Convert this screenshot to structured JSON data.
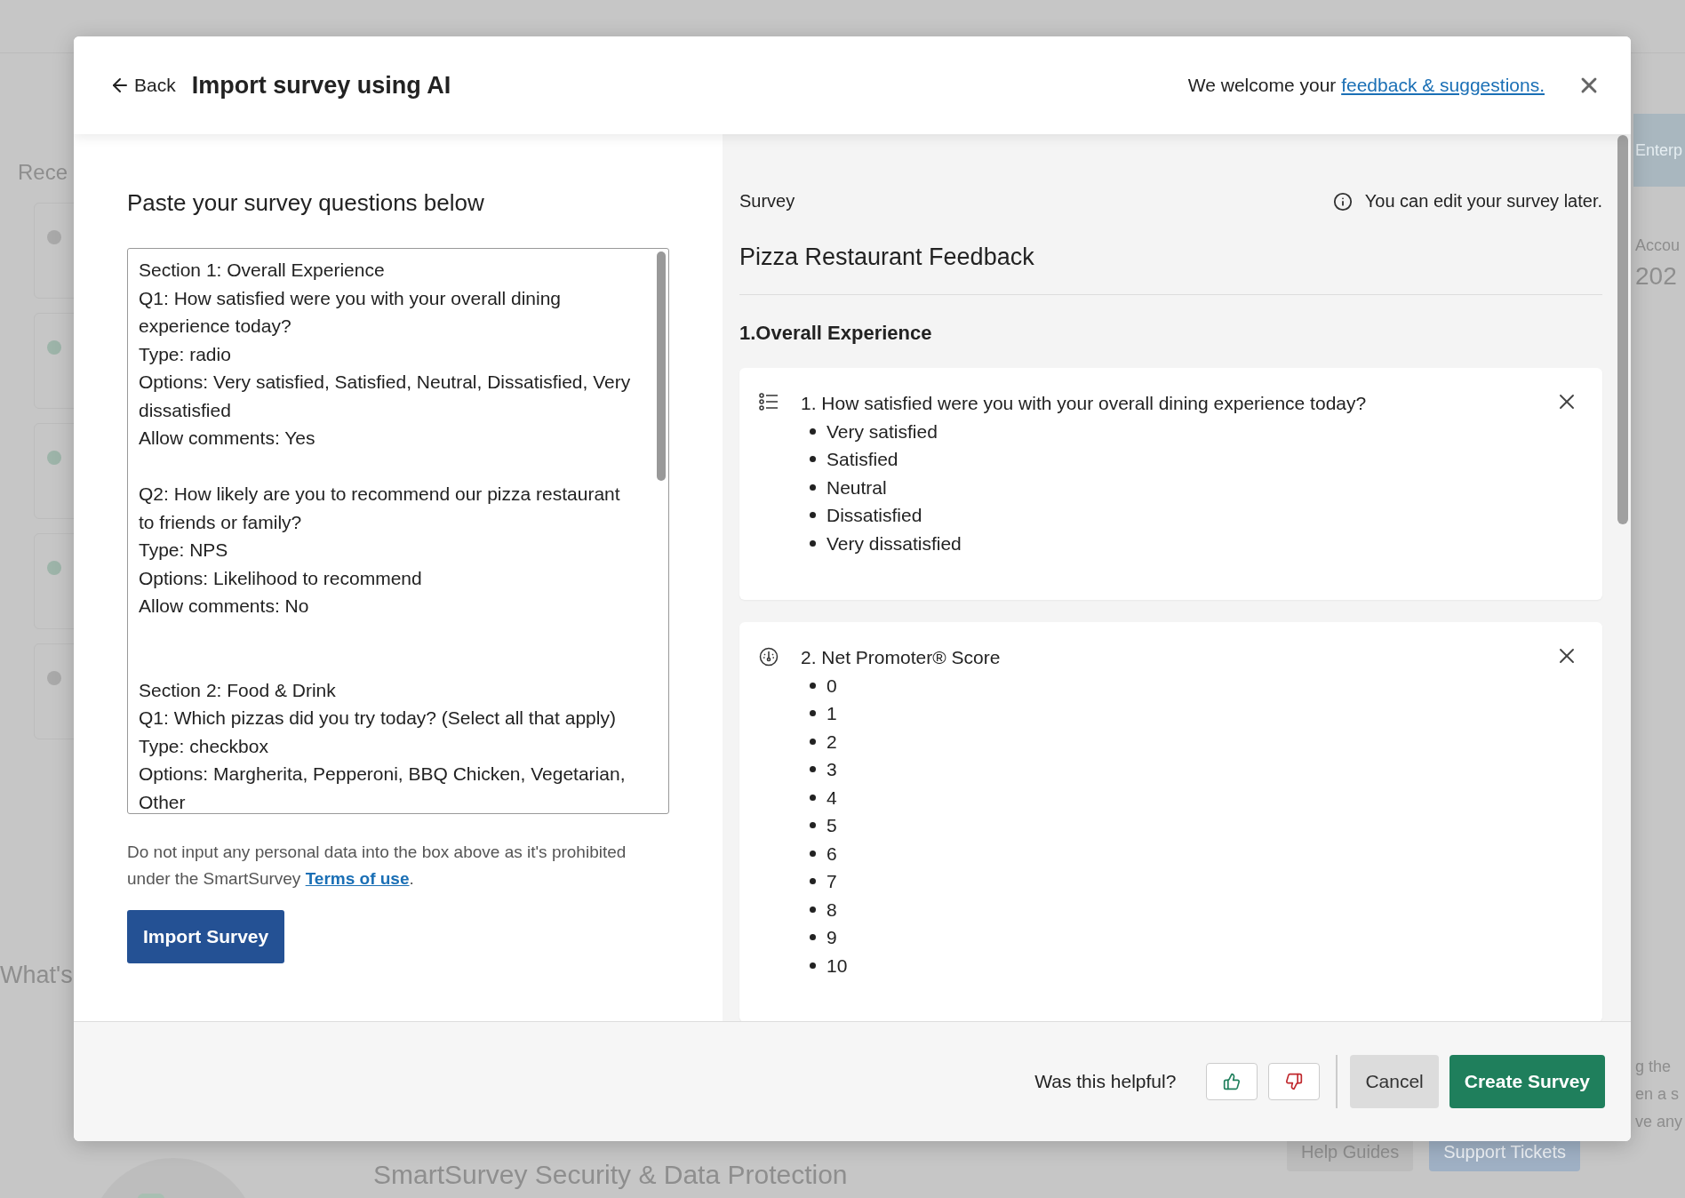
{
  "background": {
    "recent_heading": "Rece",
    "recent_cards": [
      {
        "color": "#a9a9a9"
      },
      {
        "color": "#9db4a9"
      },
      {
        "color": "#9db4a9"
      },
      {
        "color": "#9db4a9"
      },
      {
        "color": "#a9a9a9"
      }
    ],
    "whats_heading": "What's",
    "banner": "Enterp",
    "account_label": "Accou",
    "account_value": "202",
    "side_lines": [
      "g the",
      "en a s",
      "ve any"
    ],
    "buttons": [
      "Help Guides",
      "Support Tickets"
    ],
    "article_title": "SmartSurvey Security & Data Protection"
  },
  "modal": {
    "back": "Back",
    "title": "Import survey using AI",
    "feedback_prefix": "We welcome your",
    "feedback_link": "feedback & suggestions.",
    "input_panel": {
      "heading": "Paste your survey questions below",
      "questions_text": "Section 1: Overall Experience\nQ1: How satisfied were you with your overall dining experience today?\nType: radio\nOptions: Very satisfied, Satisfied, Neutral, Dissatisfied, Very dissatisfied\nAllow comments: Yes\n\nQ2: How likely are you to recommend our pizza restaurant to friends or family?\nType: NPS\nOptions: Likelihood to recommend\nAllow comments: No\n\n\nSection 2: Food & Drink\nQ1: Which pizzas did you try today? (Select all that apply)\nType: checkbox\nOptions: Margherita, Pepperoni, BBQ Chicken, Vegetarian, Other",
      "disclaimer_before": "Do not input any personal data into the box above as it's prohibited under the SmartSurvey",
      "terms_link": "Terms of use",
      "disclaimer_after": ".",
      "import_button": "Import Survey"
    },
    "preview": {
      "label": "Survey",
      "hint": "You can edit your survey later.",
      "survey_title": "Pizza Restaurant Feedback",
      "section_title": "1.Overall Experience",
      "questions": [
        {
          "kind": "choice",
          "text": "1. How satisfied were you with your overall dining experience today?",
          "options": [
            "Very satisfied",
            "Satisfied",
            "Neutral",
            "Dissatisfied",
            "Very dissatisfied"
          ]
        },
        {
          "kind": "nps",
          "text": "2. Net Promoter® Score",
          "options": [
            "0",
            "1",
            "2",
            "3",
            "4",
            "5",
            "6",
            "7",
            "8",
            "9",
            "10"
          ]
        }
      ]
    },
    "footer": {
      "helpful_prompt": "Was this helpful?",
      "cancel": "Cancel",
      "create": "Create Survey"
    }
  }
}
